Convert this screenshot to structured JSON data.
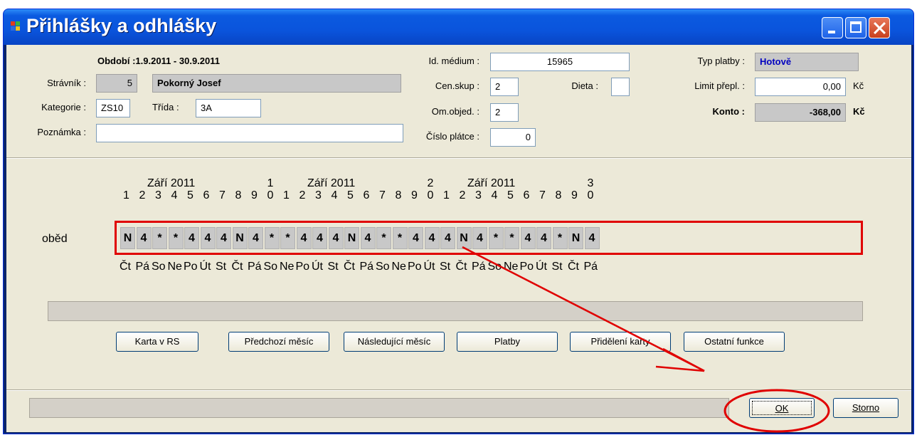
{
  "window": {
    "title": "Přihlášky a odhlášky"
  },
  "header": {
    "period": "Období :1.9.2011 - 30.9.2011",
    "diner_label": "Strávník :",
    "diner_id": "5",
    "diner_name": "Pokorný Josef",
    "category_label": "Kategorie :",
    "category_value": "ZS10",
    "class_label": "Třída :",
    "class_value": "3A",
    "note_label": "Poznámka :",
    "note_value": "",
    "medium_label": "Id. médium :",
    "medium_value": "15965",
    "price_group_label": "Cen.skup :",
    "price_group_value": "2",
    "diet_label": "Dieta :",
    "diet_value": "",
    "order_limit_label": "Om.objed. :",
    "order_limit_value": "2",
    "payer_label": "Číslo plátce :",
    "payer_value": "0",
    "payment_type_label": "Typ platby :",
    "payment_type_value": "Hotově",
    "overdraft_label": "Limit přepl. :",
    "overdraft_value": "0,00",
    "overdraft_unit": "Kč",
    "account_label": "Konto :",
    "account_value": "-368,00",
    "account_unit": "Kč"
  },
  "calendar": {
    "month_labels": [
      "Září 2011",
      "Září 2011",
      "Září 2011"
    ],
    "day_tens": [
      "",
      "",
      "",
      "",
      "",
      "",
      "",
      "",
      "",
      "1",
      "",
      "",
      "",
      "",
      "",
      "",
      "",
      "",
      "",
      "2",
      "",
      "",
      "",
      "",
      "",
      "",
      "",
      "",
      "",
      "3"
    ],
    "day_units": [
      "1",
      "2",
      "3",
      "4",
      "5",
      "6",
      "7",
      "8",
      "9",
      "0",
      "1",
      "2",
      "3",
      "4",
      "5",
      "6",
      "7",
      "8",
      "9",
      "0",
      "1",
      "2",
      "3",
      "4",
      "5",
      "6",
      "7",
      "8",
      "9",
      "0"
    ],
    "meal_label": "oběd",
    "meals": [
      "N",
      "4",
      "*",
      "*",
      "4",
      "4",
      "4",
      "N",
      "4",
      "*",
      "*",
      "4",
      "4",
      "4",
      "N",
      "4",
      "*",
      "*",
      "4",
      "4",
      "4",
      "N",
      "4",
      "*",
      "*",
      "4",
      "4",
      "*",
      "N",
      "4"
    ],
    "weekdays": [
      "Čt",
      "Pá",
      "So",
      "Ne",
      "Po",
      "Út",
      "St",
      "Čt",
      "Pá",
      "So",
      "Ne",
      "Po",
      "Út",
      "St",
      "Čt",
      "Pá",
      "So",
      "Ne",
      "Po",
      "Út",
      "St",
      "Čt",
      "Pá",
      "So",
      "Ne",
      "Po",
      "Út",
      "St",
      "Čt",
      "Pá"
    ]
  },
  "buttons": {
    "card_rs": "Karta v RS",
    "prev_month": "Předchozí měsíc",
    "next_month": "Následující měsíc",
    "payments": "Platby",
    "assign_card": "Přidělení karty",
    "other": "Ostatní funkce",
    "ok": "OK",
    "cancel": "Storno"
  },
  "colors": {
    "annotation": "#e00000",
    "titlebar": "#0a54dc"
  }
}
